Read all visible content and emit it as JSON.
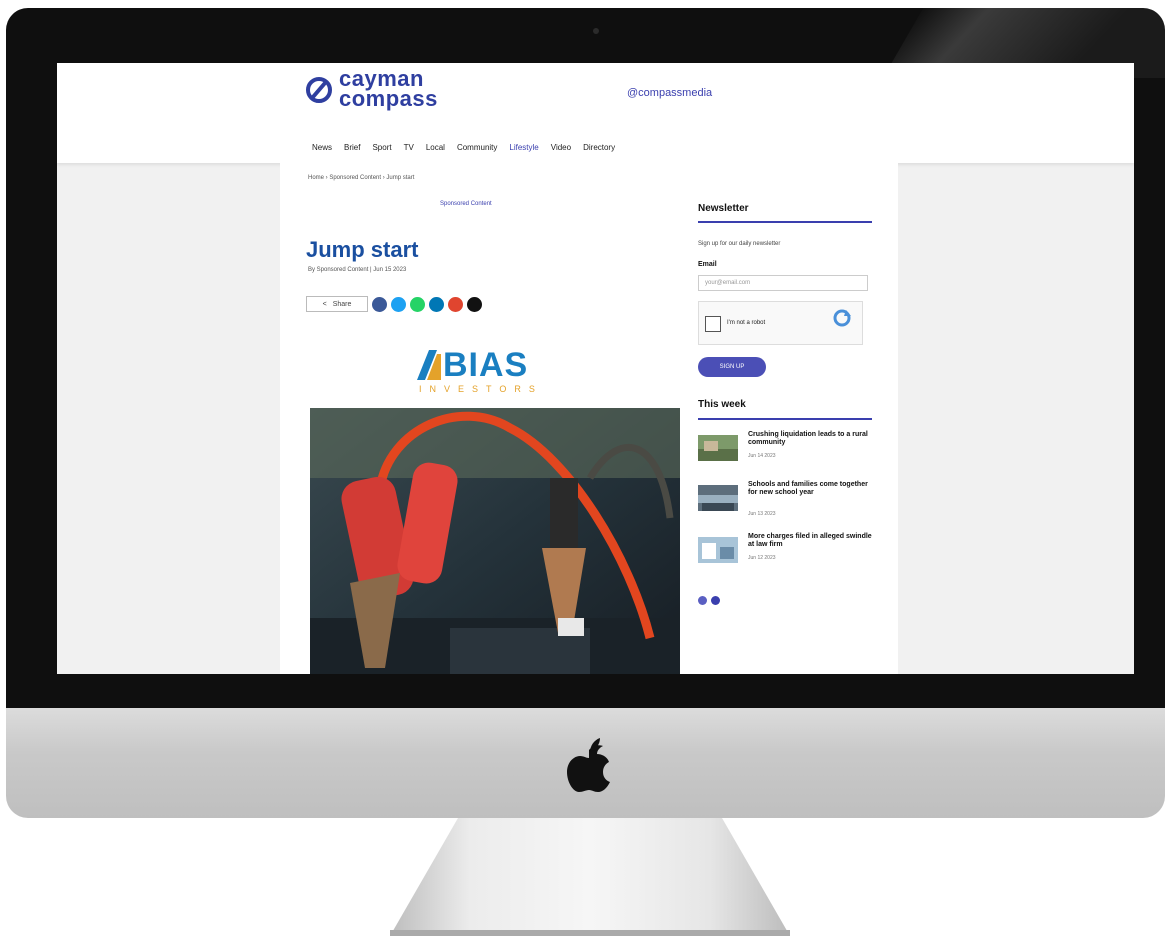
{
  "site": {
    "logo_line1": "cayman",
    "logo_line2": "compass",
    "compass_media": "@compassmedia"
  },
  "nav": {
    "items": [
      "News",
      "Brief",
      "Sport",
      "TV",
      "Local",
      "Community",
      "Lifestyle",
      "Video",
      "Directory"
    ]
  },
  "breadcrumb": "Home  ›  Sponsored Content  ›  Jump start",
  "sponsor_line": "Sponsored Content",
  "article": {
    "title": "Jump start",
    "meta": "By Sponsored Content  |  Jun 15 2023",
    "share_label": "Share"
  },
  "sponsor_logo": {
    "name": "BIAS",
    "sub": "INVESTORS",
    "colors": {
      "blue": "#1a7fc1",
      "orange": "#e4a22a"
    }
  },
  "sidebar": {
    "newsletter": {
      "heading": "Newsletter",
      "description": "Sign up for our daily newsletter",
      "email_label": "Email",
      "email_placeholder": "your@email.com",
      "captcha_label": "I'm not a robot",
      "signup_label": "SIGN UP"
    },
    "this_week": {
      "heading": "This week",
      "items": [
        {
          "title": "Crushing liquidation leads to a rural community",
          "date": "Jun 14 2023"
        },
        {
          "title": "Schools and families come together for new school year",
          "date": "Jun 13 2023"
        },
        {
          "title": "More charges filed in alleged swindle at law firm",
          "date": "Jun 12 2023"
        }
      ]
    }
  },
  "colors": {
    "brand": "#3a3fae",
    "title": "#1a4fa0"
  }
}
